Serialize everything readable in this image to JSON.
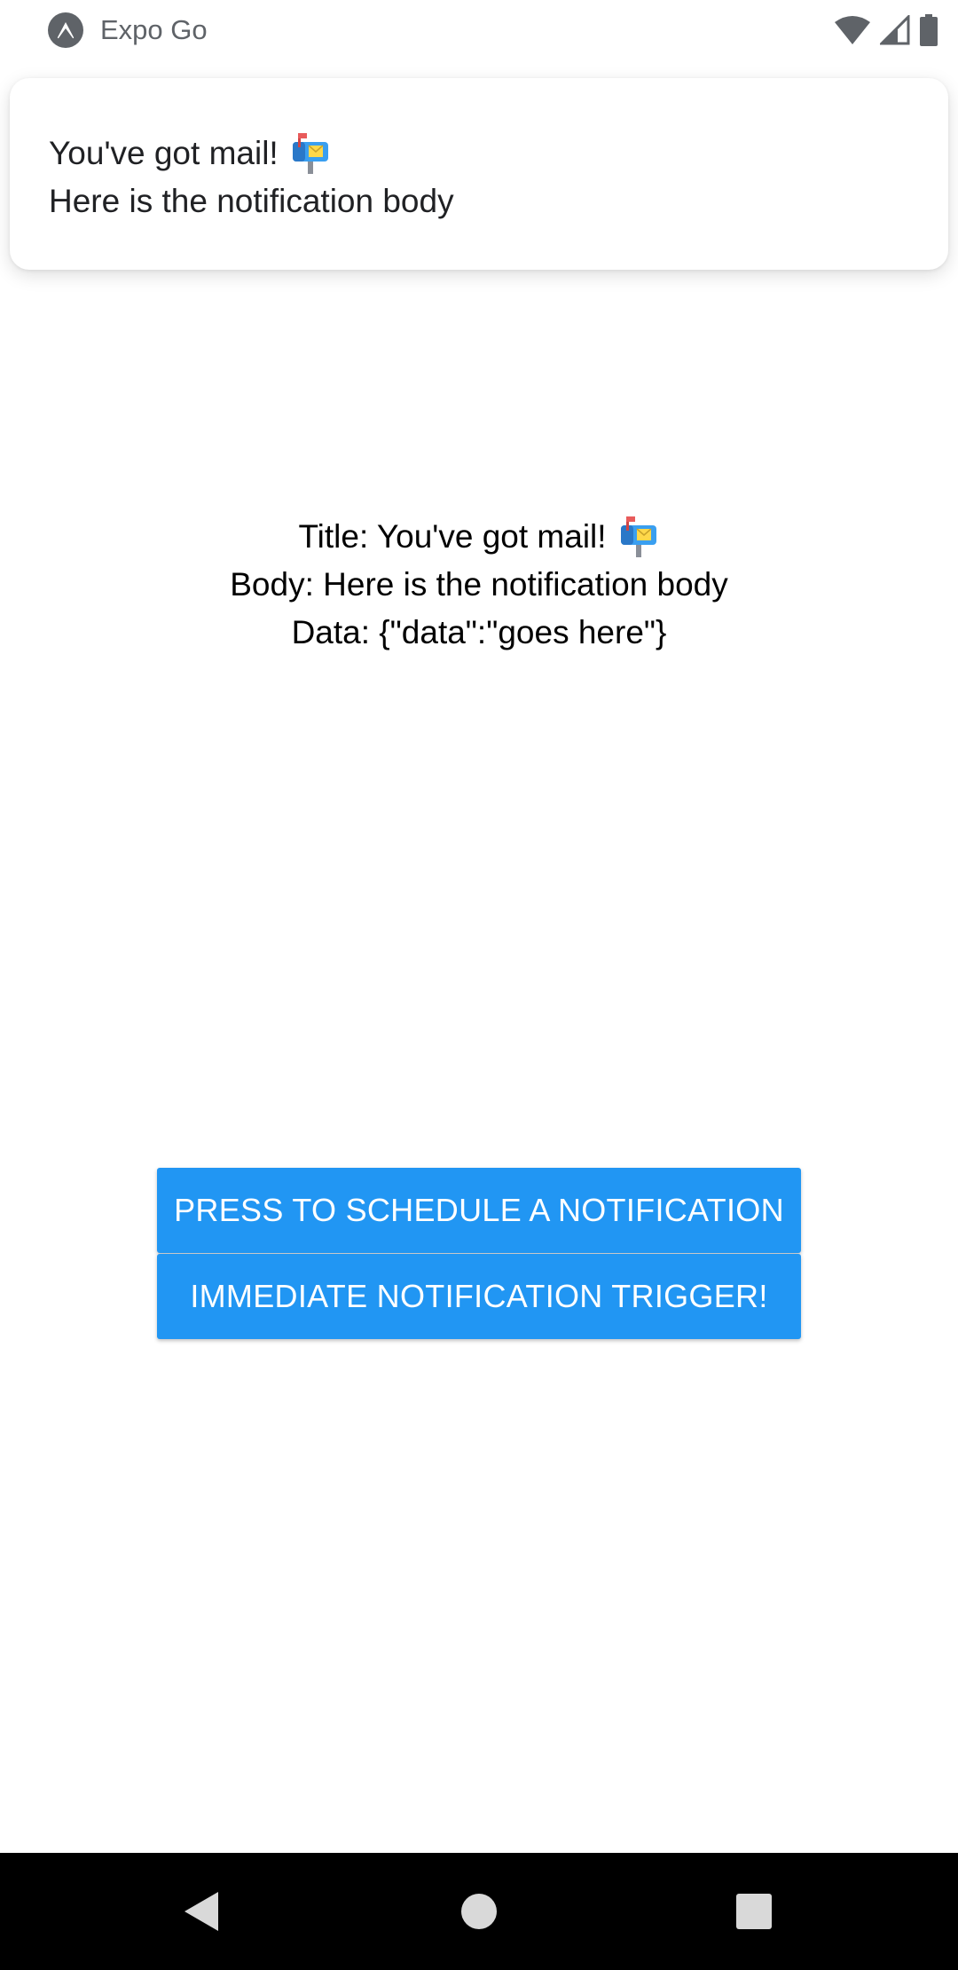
{
  "status_bar": {
    "app_name": "Expo Go",
    "app_icon": "expo-logo-icon",
    "icons": [
      "wifi-icon",
      "cell-signal-icon",
      "battery-icon"
    ]
  },
  "notification": {
    "title": "You've got mail!",
    "title_emoji": "mailbox-icon",
    "body": "Here is the notification body"
  },
  "info": {
    "title_line": "Title: You've got mail!",
    "title_emoji": "mailbox-icon",
    "body_line": "Body: Here is the notification body",
    "data_line": "Data: {\"data\":\"goes here\"}"
  },
  "buttons": {
    "schedule_label": "PRESS TO SCHEDULE A NOTIFICATION",
    "immediate_label": "IMMEDIATE NOTIFICATION TRIGGER!"
  },
  "nav_bar": {
    "icons": [
      "back-icon",
      "home-icon",
      "recents-icon"
    ]
  },
  "colors": {
    "button": "#2196f3",
    "button_text": "#ffffff",
    "nav_bar": "#000000",
    "status_text": "#5f6368"
  }
}
